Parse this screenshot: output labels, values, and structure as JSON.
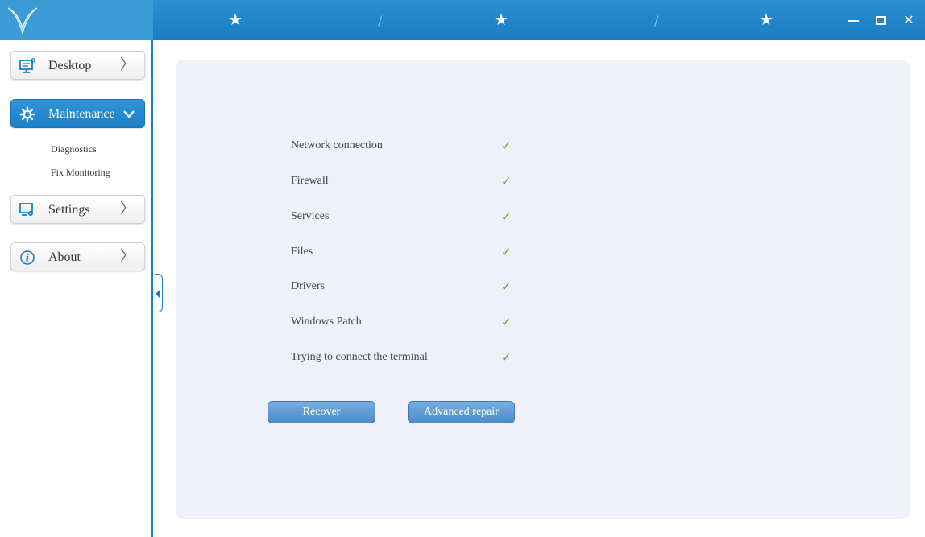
{
  "titlebar": {
    "decorations": [
      "★",
      "/",
      "★",
      "/",
      "★"
    ],
    "controls": {
      "minimize": "minimize-icon",
      "maximize": "maximize-icon",
      "close": "✕"
    }
  },
  "sidebar": {
    "items": [
      {
        "label": "Desktop",
        "icon": "desktop-icon",
        "chevron": "〉"
      },
      {
        "label": "Maintenance",
        "icon": "gear-icon",
        "chevron": "⌄"
      },
      {
        "label": "Settings",
        "icon": "settings-monitor-icon",
        "chevron": "〉"
      },
      {
        "label": "About",
        "icon": "info-icon",
        "chevron": "〉"
      }
    ],
    "subitems": [
      "Diagnostics",
      "Fix Monitoring"
    ]
  },
  "checks": [
    {
      "label": "Network connection",
      "status": "✓"
    },
    {
      "label": "Firewall",
      "status": "✓"
    },
    {
      "label": "Services",
      "status": "✓"
    },
    {
      "label": "Files",
      "status": "✓"
    },
    {
      "label": "Drivers",
      "status": "✓"
    },
    {
      "label": "Windows Patch",
      "status": "✓"
    },
    {
      "label": "Trying to connect the terminal",
      "status": "✓"
    }
  ],
  "actions": {
    "recover": "Recover",
    "advanced_repair": "Advanced repair"
  },
  "colors": {
    "accent": "#1a7dc2",
    "check": "#5ba217",
    "panel": "#eef1f9"
  }
}
